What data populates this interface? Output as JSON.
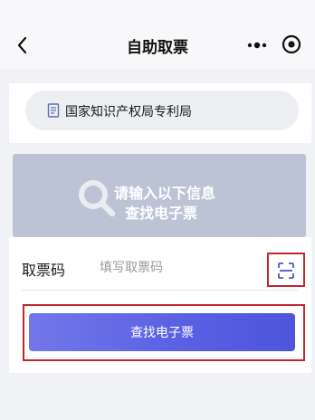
{
  "header": {
    "title": "自助取票",
    "back_icon": "chevron-left-icon",
    "more_icon": "more-dots-icon",
    "target_icon": "target-icon"
  },
  "bureau": {
    "icon": "document-icon",
    "name": "国家知识产权局专利局"
  },
  "hint": {
    "icon": "search-icon",
    "line1": "请输入以下信息",
    "line2": "查找电子票"
  },
  "form": {
    "code_label": "取票码",
    "code_placeholder": "填写取票码",
    "code_value": "",
    "scan_icon": "scan-icon",
    "submit_label": "查找电子票"
  },
  "colors": {
    "accent_start": "#7277ea",
    "accent_end": "#4e54dc",
    "hint_banner": "#bcc3d4",
    "highlight_border": "#c3262e"
  }
}
